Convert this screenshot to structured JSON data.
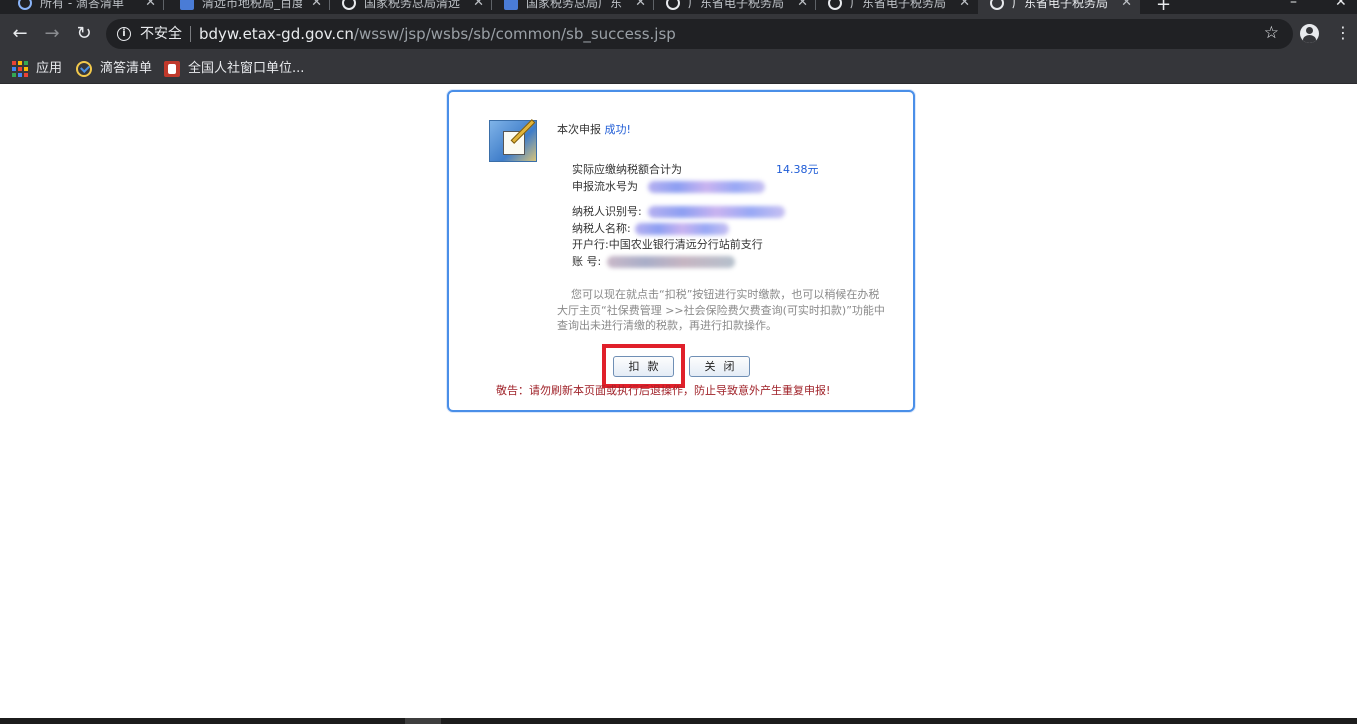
{
  "browser": {
    "tabs": [
      {
        "title": "所有 - 滴答清单",
        "active": false
      },
      {
        "title": "清远市地税局_百度",
        "active": false
      },
      {
        "title": "国家税务总局清远",
        "active": false
      },
      {
        "title": "国家税务总局广东",
        "active": false
      },
      {
        "title": "广东省电子税务局",
        "active": false
      },
      {
        "title": "广东省电子税务局",
        "active": false
      },
      {
        "title": "广东省电子税务局",
        "active": true
      }
    ],
    "security_label": "不安全",
    "url_host": "bdyw.etax-gd.gov.cn",
    "url_path": "/wssw/jsp/wsbs/sb/common/sb_success.jsp",
    "bookmarks": [
      {
        "label": "应用",
        "icon": "apps-grid-icon"
      },
      {
        "label": "滴答清单",
        "icon": "dida-check-icon"
      },
      {
        "label": "全国人社窗口单位...",
        "icon": "mhrss-icon"
      }
    ]
  },
  "dialog": {
    "title_prefix": "本次申报",
    "title_status": "成功!",
    "amount_label": "实际应缴纳税额合计为",
    "amount_value": "14.38元",
    "serial_label": "申报流水号为",
    "taxpayer_id_label": "纳税人识别号:",
    "taxpayer_name_label": "纳税人名称:",
    "bank_label": "开户行:",
    "bank_value": "中国农业银行清远分行站前支行",
    "account_label": "账  号:",
    "hint": "您可以现在就点击“扣税”按钮进行实时缴款，也可以稍候在办税大厅主页“社保费管理 >>社会保险费欠费查询(可实时扣款)”功能中查询出未进行清缴的税款，再进行扣款操作。",
    "buttons": {
      "deduct": "扣款",
      "close": "关闭"
    },
    "warning": "敬告：请勿刷新本页面或执行后退操作，防止导致意外产生重复申报!"
  },
  "colors": {
    "dialog_border": "#4a8fe8",
    "success_text": "#1f5cd6",
    "warning_text": "#a0232a",
    "highlight_box": "#e0202a"
  }
}
